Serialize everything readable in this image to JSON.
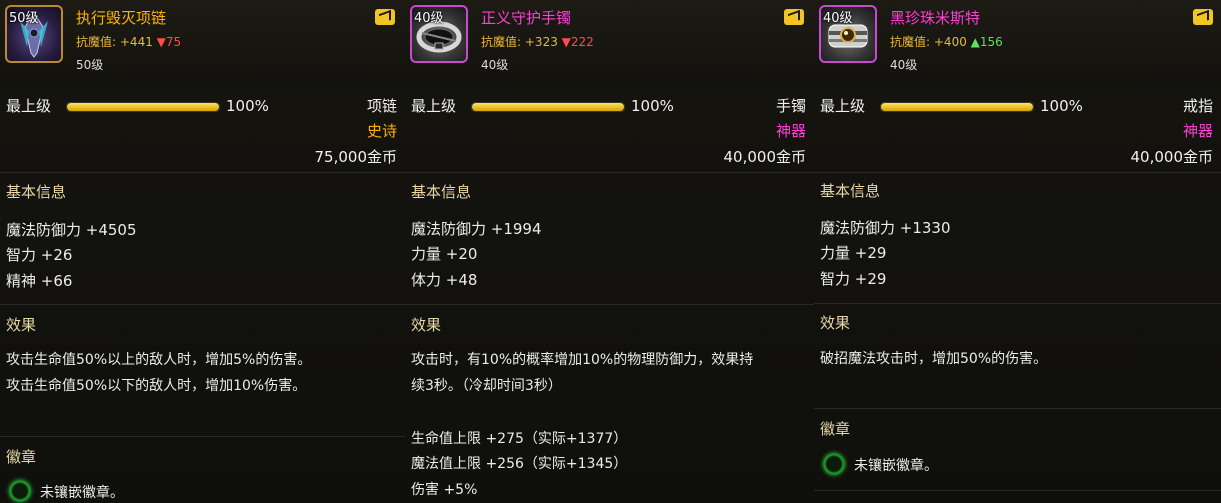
{
  "items": [
    {
      "level_badge": "50级",
      "name": "执行毁灭项链",
      "stat_label": "抗魔值:",
      "stat_value": "+441",
      "stat_delta_dir": "down",
      "stat_delta_arrow": "▼",
      "stat_delta": "75",
      "level_text": "50级",
      "tier_label": "最上级",
      "tier_progress_percent": 100,
      "tier_pct_text": "100%",
      "slot": "项链",
      "rarity": "史诗",
      "rarity_class": "epic",
      "price": "75,000金币",
      "basic_title": "基本信息",
      "basic_stats": [
        "魔法防御力 +4505",
        "智力 +26",
        "精神 +66"
      ],
      "effect_title": "效果",
      "effect_lines": [
        "攻击生命值50%以上的敌人时，增加5%的伤害。",
        "攻击生命值50%以下的敌人时，增加10%伤害。"
      ],
      "extra_stats": [],
      "emblem_title": "徽章",
      "emblem_text": "未镶嵌徽章。",
      "icon": "necklace-icon"
    },
    {
      "level_badge": "40级",
      "name": "正义守护手镯",
      "stat_label": "抗魔值:",
      "stat_value": "+323",
      "stat_delta_dir": "down",
      "stat_delta_arrow": "▼",
      "stat_delta": "222",
      "level_text": "40级",
      "tier_label": "最上级",
      "tier_progress_percent": 100,
      "tier_pct_text": "100%",
      "slot": "手镯",
      "rarity": "神器",
      "rarity_class": "artifact",
      "price": "40,000金币",
      "basic_title": "基本信息",
      "basic_stats": [
        "魔法防御力 +1994",
        "力量 +20",
        "体力 +48"
      ],
      "effect_title": "效果",
      "effect_lines": [
        "攻击时，有10%的概率增加10%的物理防御力，效果持",
        "续3秒。（冷却时间3秒）"
      ],
      "extra_stats": [
        "生命值上限 +275（实际+1377）",
        "魔法值上限 +256（实际+1345）",
        "伤害 +5%"
      ],
      "icon": "bracelet-icon"
    },
    {
      "level_badge": "40级",
      "name": "黑珍珠米斯特",
      "stat_label": "抗魔值:",
      "stat_value": "+400",
      "stat_delta_dir": "up",
      "stat_delta_arrow": "▲",
      "stat_delta": "156",
      "level_text": "40级",
      "tier_label": "最上级",
      "tier_progress_percent": 100,
      "tier_pct_text": "100%",
      "slot": "戒指",
      "rarity": "神器",
      "rarity_class": "artifact",
      "price": "40,000金币",
      "basic_title": "基本信息",
      "basic_stats": [
        "魔法防御力 +1330",
        "力量 +29",
        "智力 +29"
      ],
      "effect_title": "效果",
      "effect_lines": [
        "破招魔法攻击时，增加50%的伤害。"
      ],
      "extra_stats": [],
      "emblem_title": "徽章",
      "emblem_text": "未镶嵌徽章。",
      "icon": "ring-icon"
    }
  ],
  "colors": {
    "epic": "#ffb400",
    "artifact": "#ff3dd8",
    "stat_label": "#e8b93a",
    "delta_down": "#ff4b4b",
    "delta_up": "#5ee05e",
    "progress": "#ffd83a"
  }
}
